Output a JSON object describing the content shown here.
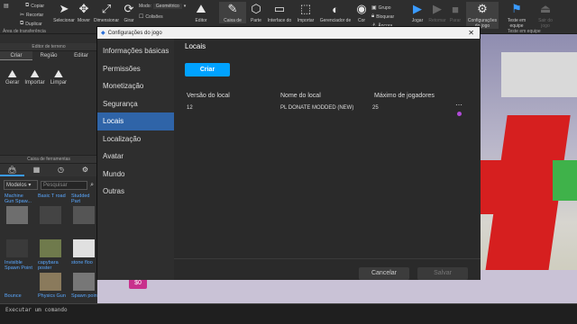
{
  "ribbon": {
    "clipboard": {
      "copy": "Copiar",
      "cut": "Recortar",
      "paste": "Colar",
      "duplicate": "Duplicar"
    },
    "tools": [
      {
        "name": "select",
        "label": "Selecionar"
      },
      {
        "name": "move",
        "label": "Mover"
      },
      {
        "name": "scale",
        "label": "Dimensionar"
      },
      {
        "name": "rotate",
        "label": "Girar"
      }
    ],
    "mode_label": "Modo:",
    "mode_value": "Geométrico",
    "collisions_label": "Colisões",
    "terrain_editor_label": "Editor",
    "insert": [
      {
        "name": "toolbox",
        "label": "Caixa de"
      },
      {
        "name": "part",
        "label": "Parte"
      },
      {
        "name": "ui",
        "label": "Interface do"
      },
      {
        "name": "import",
        "label": "Importar"
      },
      {
        "name": "material",
        "label": "Gerenciador de"
      },
      {
        "name": "color",
        "label": "Cor"
      }
    ],
    "group_label": "Grupo",
    "lock_label": "Bloquear",
    "anchor_label": "Âncora",
    "play_label": "Jogar",
    "resume_label": "Retomar",
    "stop_label": "Parar",
    "settings_label": "Configurações",
    "settings_label2": "do jogo",
    "team_test_label": "Teste em",
    "team_test_label2": "equipe",
    "exit_label": "Sair do",
    "exit_label2": "jogo",
    "section_transfer": "Área de transferência",
    "section_test": "Teste em equipe"
  },
  "terrain": {
    "title": "Editor de terreno",
    "tabs": [
      "Criar",
      "Região",
      "Editar"
    ],
    "tools": [
      {
        "label": "Gerar"
      },
      {
        "label": "Importar"
      },
      {
        "label": "Limpar"
      }
    ]
  },
  "toolbox": {
    "title": "Caixa de ferramentas",
    "category": "Modelos",
    "search_placeholder": "Pesquisar",
    "items": [
      {
        "label": "Machine Gun Spaw...",
        "color": "#6e6e6e"
      },
      {
        "label": "Basic T road",
        "color": "#444444"
      },
      {
        "label": "Studded Part",
        "color": "#555555"
      },
      {
        "label": "",
        "color": "#3a3a3a"
      },
      {
        "label": "",
        "color": "#6f7a4c"
      },
      {
        "label": "",
        "color": "#e0e0e0"
      },
      {
        "label": "Invisible Spawn Point",
        "color": "#2e2e2e"
      },
      {
        "label": "capybara poster",
        "color": "#8a7a5c"
      },
      {
        "label": "stone floo",
        "color": "#777777"
      },
      {
        "label": "Bounce",
        "color": "#d04040"
      },
      {
        "label": "Physics Gun",
        "color": "#3aa8d8"
      },
      {
        "label": "Spawn point",
        "color": "#bbbbbb"
      }
    ]
  },
  "command_bar": {
    "placeholder": "Executar um comando"
  },
  "dialog": {
    "title": "Configurações do jogo",
    "nav": [
      "Informações básicas",
      "Permissões",
      "Monetização",
      "Segurança",
      "Locais",
      "Localização",
      "Avatar",
      "Mundo",
      "Outras"
    ],
    "active_nav_index": 4,
    "page_title": "Locais",
    "create_label": "Criar",
    "columns": [
      "Versão do local",
      "Nome do local",
      "Máximo de jogadores"
    ],
    "rows": [
      {
        "version": "12",
        "name": "PL DONATE MODDED (NEW)",
        "max_players": "25"
      }
    ],
    "more_icon": "⋯",
    "cancel_label": "Cancelar",
    "save_label": "Salvar"
  },
  "viewport": {
    "money_badge": "$0"
  },
  "colors": {
    "accent": "#00a2ff",
    "nav_active": "#2f64a8",
    "panel_bg": "#2e2e2e"
  }
}
